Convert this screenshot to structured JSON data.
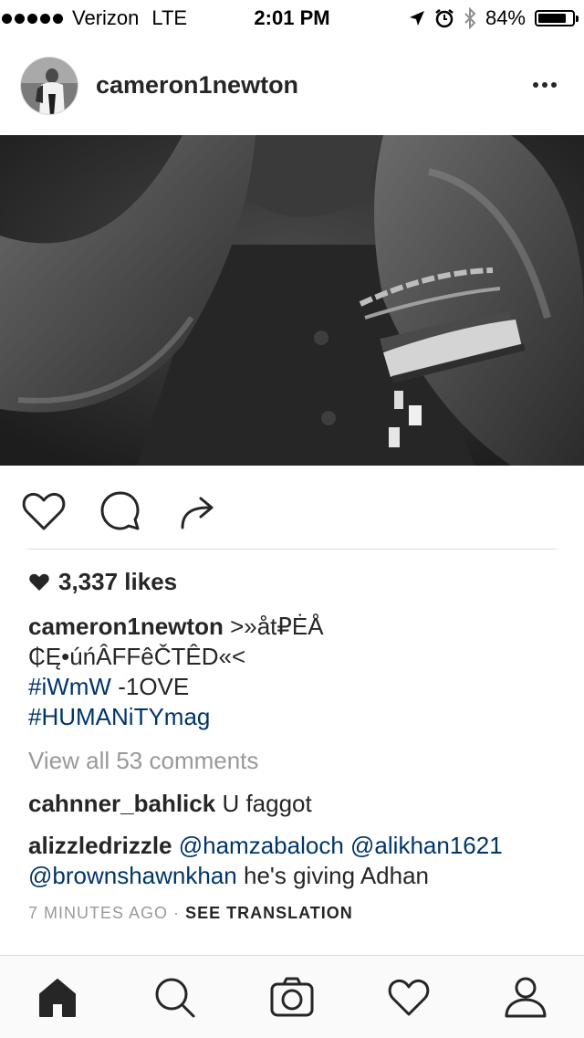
{
  "status_bar": {
    "carrier": "Verizon",
    "network": "LTE",
    "time": "2:01 PM",
    "battery": "84%",
    "battery_level": 0.84,
    "icons": [
      "location-arrow-icon",
      "alarm-icon",
      "bluetooth-icon",
      "battery-icon"
    ]
  },
  "post": {
    "username": "cameron1newton",
    "likes": "3,337 likes",
    "caption": {
      "username": "cameron1newton",
      "text_line1": ">»åt₽ĖÅ",
      "text_line2": "₵Ę•úńÂFFêČTÊD«<",
      "hashtag1": "#iWmW",
      "after_hashtag1": "-1OVE",
      "hashtag2": "#HUMANiTYmag"
    },
    "view_all": "View all 53 comments",
    "comments": [
      {
        "username": "cahnner_bahlick",
        "text": "U faggot"
      },
      {
        "username": "alizzledrizzle",
        "mentions": [
          "@hamzabaloch",
          "@alikhan1621",
          "@brownshawnkhan"
        ],
        "text": "he's giving Adhan"
      }
    ],
    "time_ago": "7 MINUTES AGO",
    "separator": "·",
    "see_translation": "SEE TRANSLATION"
  },
  "icons": {
    "actions": [
      "heart-icon",
      "comment-icon",
      "share-icon"
    ],
    "tabs": [
      "home-icon",
      "search-icon",
      "camera-icon",
      "activity-heart-icon",
      "profile-icon"
    ]
  },
  "colors": {
    "link": "#003569",
    "muted": "#999999",
    "text": "#262626"
  }
}
